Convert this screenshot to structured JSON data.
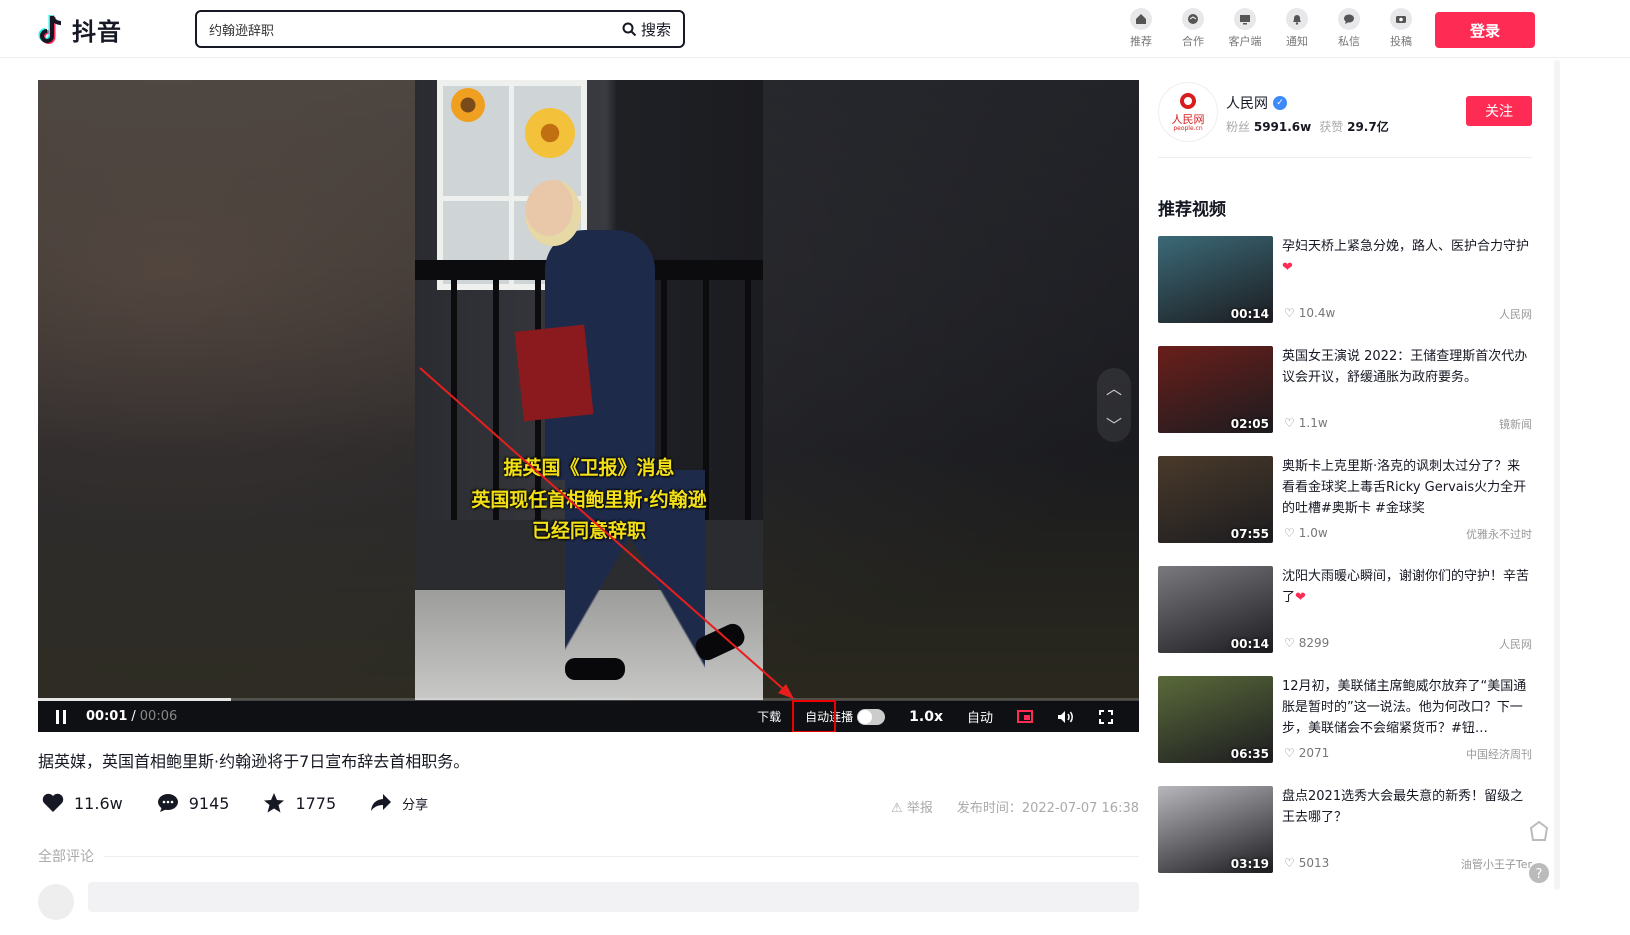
{
  "header": {
    "logo_text": "抖音",
    "search": {
      "value": "约翰逊辞职",
      "button_label": "搜索"
    },
    "nav": [
      {
        "label": "推荐",
        "icon": "home-icon"
      },
      {
        "label": "合作",
        "icon": "handshake-icon"
      },
      {
        "label": "客户端",
        "icon": "monitor-icon"
      },
      {
        "label": "通知",
        "icon": "bell-icon"
      },
      {
        "label": "私信",
        "icon": "message-icon"
      },
      {
        "label": "投稿",
        "icon": "upload-icon"
      }
    ],
    "login_label": "登录",
    "accent_color": "#fe2c55"
  },
  "player": {
    "subtitles": [
      "据英国《卫报》消息",
      "英国现任首相鲍里斯·约翰逊",
      "已经同意辞职"
    ],
    "time_current": "00:01",
    "time_separator": "/",
    "time_duration": "00:06",
    "progress": 0.175,
    "download_label": "下载",
    "autoplay_label": "自动连播",
    "speed_label": "1.0x",
    "quality_label": "自动"
  },
  "video_info": {
    "caption": "据英媒，英国首相鲍里斯·约翰逊将于7日宣布辞去首相职务。",
    "likes": "11.6w",
    "comments": "9145",
    "favorites": "1775",
    "share_label": "分享",
    "report_label": "举报",
    "publish_time": "发布时间：2022-07-07 16:38",
    "comments_header": "全部评论"
  },
  "author": {
    "name": "人民网",
    "fans_label": "粉丝",
    "fans": "5991.6w",
    "likes_label": "获赞",
    "likes": "29.7亿",
    "follow_label": "关注",
    "logo_text": "人民网",
    "logo_sub": "people.cn"
  },
  "recommend": {
    "title": "推荐视频",
    "items": [
      {
        "title": "孕妇天桥上紧急分娩，路人、医护合力守护❤",
        "duration": "00:14",
        "likes": "10.4w",
        "source": "人民网",
        "thumb_color": "#3b6a78"
      },
      {
        "title": "英国女王演说 2022：王储查理斯首次代办议会开议，舒缓通胀为政府要务。",
        "duration": "02:05",
        "likes": "1.1w",
        "source": "镜新闻",
        "thumb_color": "#6a1e1a"
      },
      {
        "title": "奥斯卡上克里斯·洛克的讽刺太过分了？来看看金球奖上毒舌Ricky Gervais火力全开的吐槽#奥斯卡 #金球奖",
        "duration": "07:55",
        "likes": "1.0w",
        "source": "优雅永不过时",
        "thumb_color": "#4a3a2a"
      },
      {
        "title": "沈阳大雨暖心瞬间，谢谢你们的守护！辛苦了❤",
        "duration": "00:14",
        "likes": "8299",
        "source": "人民网",
        "thumb_color": "#7a7a7e"
      },
      {
        "title": "12月初，美联储主席鲍威尔放弃了“美国通胀是暂时的”这一说法。他为何改口？下一步，美联储会不会缩紧货币？#钮…",
        "duration": "06:35",
        "likes": "2071",
        "source": "中国经济周刊",
        "thumb_color": "#5a6a3a"
      },
      {
        "title": "盘点2021选秀大会最失意的新秀！留级之王去哪了？",
        "duration": "03:19",
        "likes": "5013",
        "source": "油管小王子Ter",
        "thumb_color": "#b8b8bc"
      }
    ]
  }
}
